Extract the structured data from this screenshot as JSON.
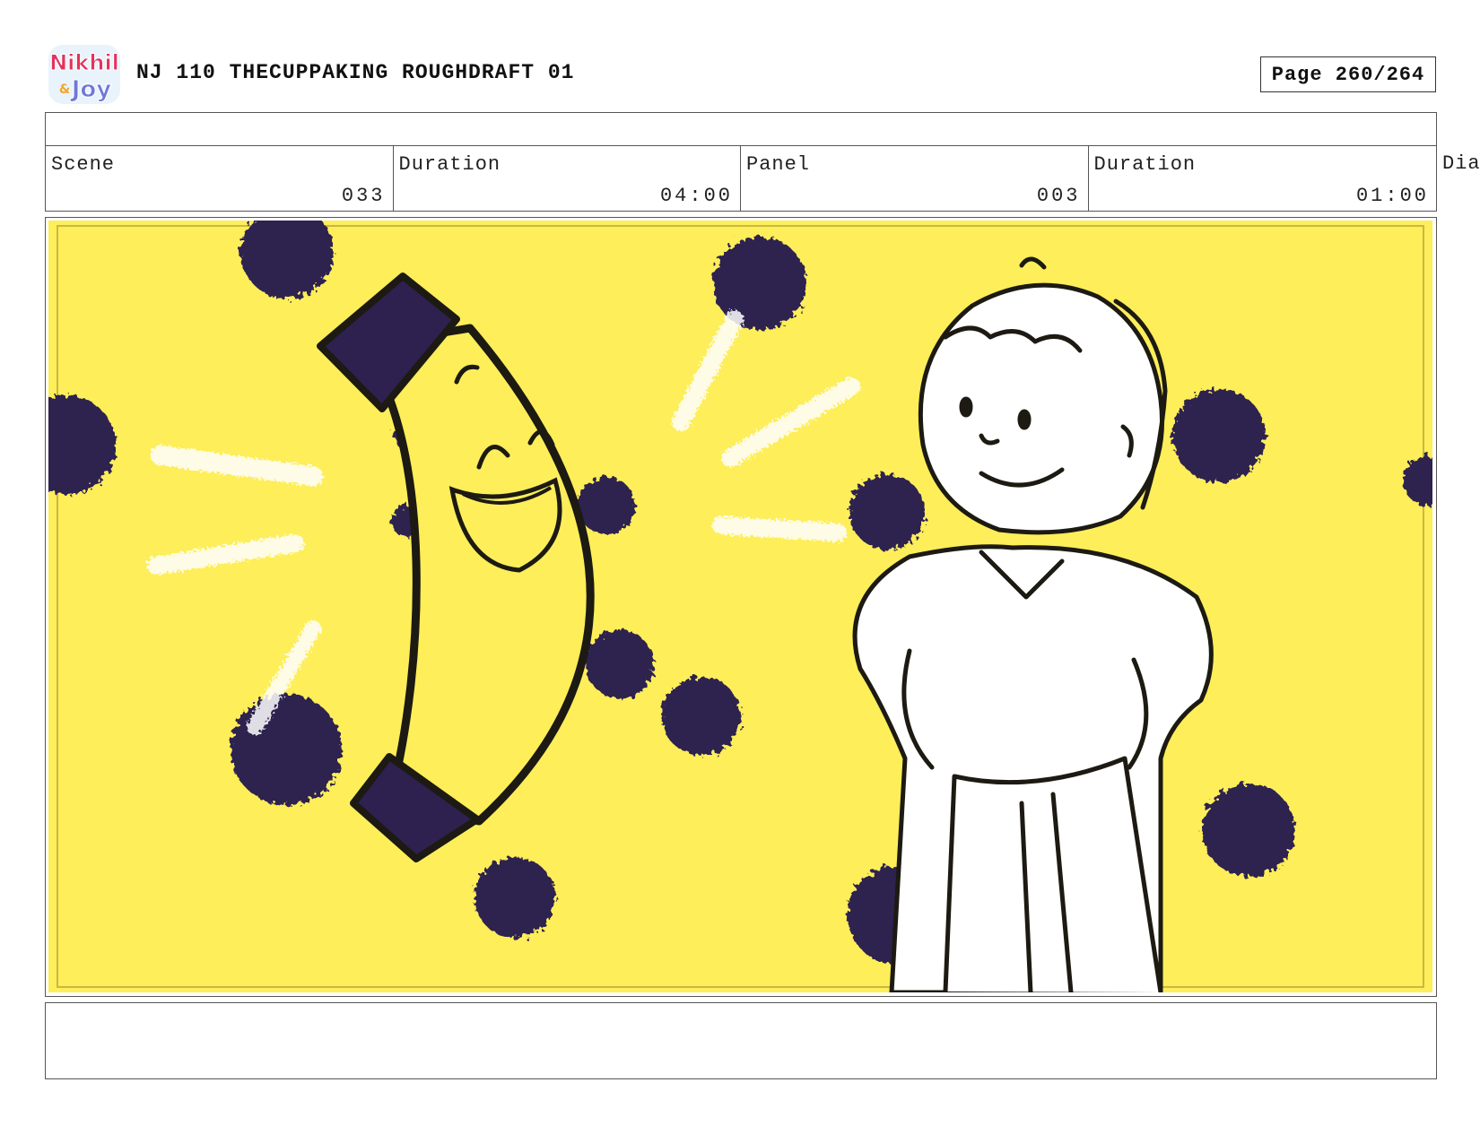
{
  "header": {
    "logo_alt": "Nikhil & Joy",
    "title": "NJ 110 THECUPPAKING ROUGHDRAFT 01",
    "page": "Page 260/264"
  },
  "info": {
    "scene_label": "Scene",
    "scene_value": "033",
    "scene_duration_label": "Duration",
    "scene_duration_value": "04:00",
    "panel_label": "Panel",
    "panel_value": "003",
    "panel_duration_label": "Duration",
    "panel_duration_value": "01:00",
    "dialogue_label": "Dia"
  },
  "panel": {
    "background_color": "#fdee5a",
    "dot_color": "#2e2150",
    "characters": [
      "banana-character",
      "boy-character"
    ]
  },
  "notes": ""
}
